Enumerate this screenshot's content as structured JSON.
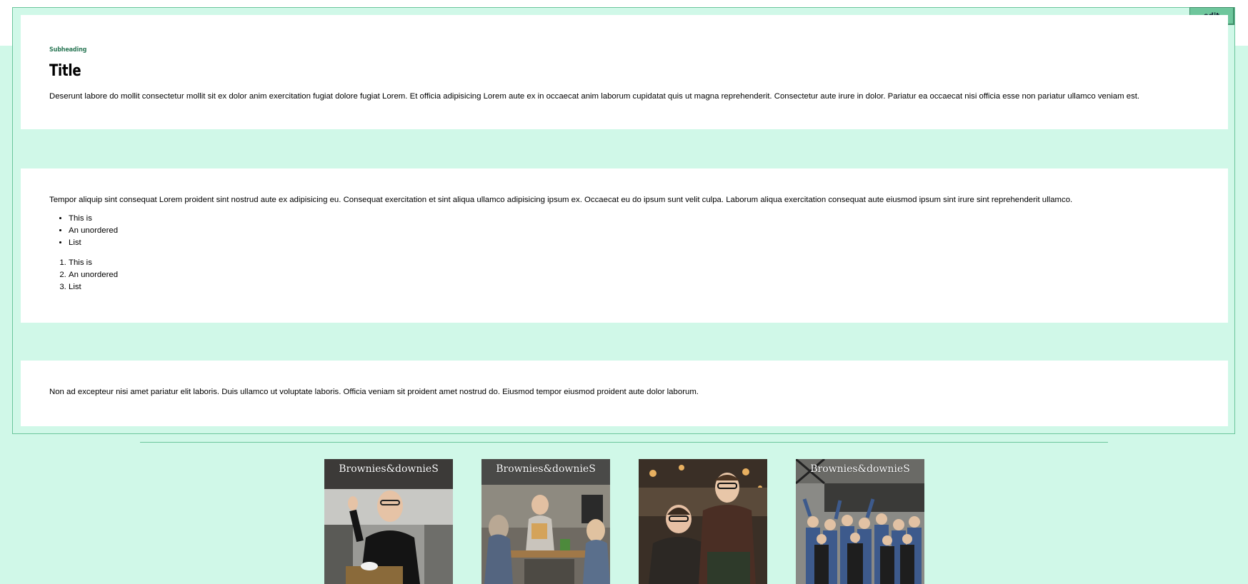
{
  "toolbar": {
    "edit_label": "edit"
  },
  "section1": {
    "subheading": "Subheading",
    "title": "Title",
    "paragraph": "Deserunt labore do mollit consectetur mollit sit ex dolor anim exercitation fugiat dolore fugiat Lorem. Et officia adipisicing Lorem aute ex in occaecat anim laborum cupidatat quis ut magna reprehenderit. Consectetur aute irure in dolor. Pariatur ea occaecat nisi officia esse non pariatur ullamco veniam est."
  },
  "section2": {
    "paragraph": "Tempor aliquip sint consequat Lorem proident sint nostrud aute ex adipisicing eu. Consequat exercitation et sint aliqua ullamco adipisicing ipsum ex. Occaecat eu do ipsum sunt velit culpa. Laborum aliqua exercitation consequat aute eiusmod ipsum sint irure sint reprehenderit ullamco.",
    "unordered_list": [
      "This is",
      "An unordered",
      "List"
    ],
    "ordered_list": [
      "This is",
      "An unordered",
      "List"
    ]
  },
  "section3": {
    "paragraph": "Non ad excepteur nisi amet pariatur elit laboris. Duis ullamco ut voluptate laboris. Officia veniam sit proident amet nostrud do. Eiusmod tempor eiusmod proident aute dolor laborum."
  },
  "gallery": {
    "sign_text": "Brownies&downieS",
    "photos": [
      "photo-waiter",
      "photo-cafe-interior",
      "photo-two-staff",
      "photo-team-group"
    ]
  },
  "colors": {
    "background": "#d0f8e8",
    "accent": "#6ec69c",
    "frame_border": "#6cc59c",
    "subheading": "#2f7a59"
  }
}
